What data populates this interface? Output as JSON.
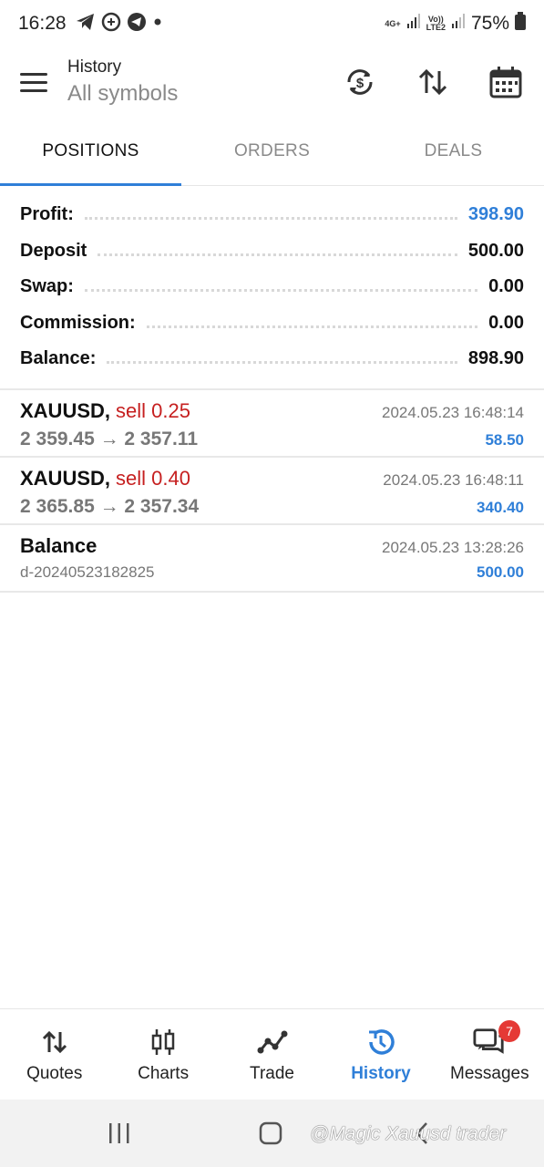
{
  "status_bar": {
    "time": "16:28",
    "network_top": "4G+",
    "volte_top": "Vo))",
    "volte_bottom": "LTE2",
    "battery": "75%"
  },
  "header": {
    "title": "History",
    "subtitle": "All symbols"
  },
  "tabs": [
    {
      "label": "POSITIONS",
      "active": true
    },
    {
      "label": "ORDERS",
      "active": false
    },
    {
      "label": "DEALS",
      "active": false
    }
  ],
  "summary": [
    {
      "label": "Profit:",
      "value": "398.90"
    },
    {
      "label": "Deposit",
      "value": "500.00"
    },
    {
      "label": "Swap:",
      "value": "0.00"
    },
    {
      "label": "Commission:",
      "value": "0.00"
    },
    {
      "label": "Balance:",
      "value": "898.90"
    }
  ],
  "deals": [
    {
      "symbol": "XAUUSD,",
      "side": "sell 0.25",
      "time": "2024.05.23 16:48:14",
      "prices": "2 359.45 → 2 357.11",
      "profit": "58.50"
    },
    {
      "symbol": "XAUUSD,",
      "side": "sell 0.40",
      "time": "2024.05.23 16:48:11",
      "prices": "2 365.85 → 2 357.34",
      "profit": "340.40"
    },
    {
      "symbol": "Balance",
      "time": "2024.05.23 13:28:26",
      "sub": "d-20240523182825",
      "profit": "500.00"
    }
  ],
  "bottom_nav": [
    {
      "label": "Quotes",
      "icon": "quotes-icon"
    },
    {
      "label": "Charts",
      "icon": "candlestick-icon"
    },
    {
      "label": "Trade",
      "icon": "trade-icon"
    },
    {
      "label": "History",
      "icon": "history-icon",
      "active": true
    },
    {
      "label": "Messages",
      "icon": "chat-icon",
      "badge": "7"
    }
  ],
  "watermark": "@Magic Xauusd trader",
  "colors": {
    "accent": "#2f7fd8",
    "sell": "#c62020",
    "badge": "#e53935"
  }
}
